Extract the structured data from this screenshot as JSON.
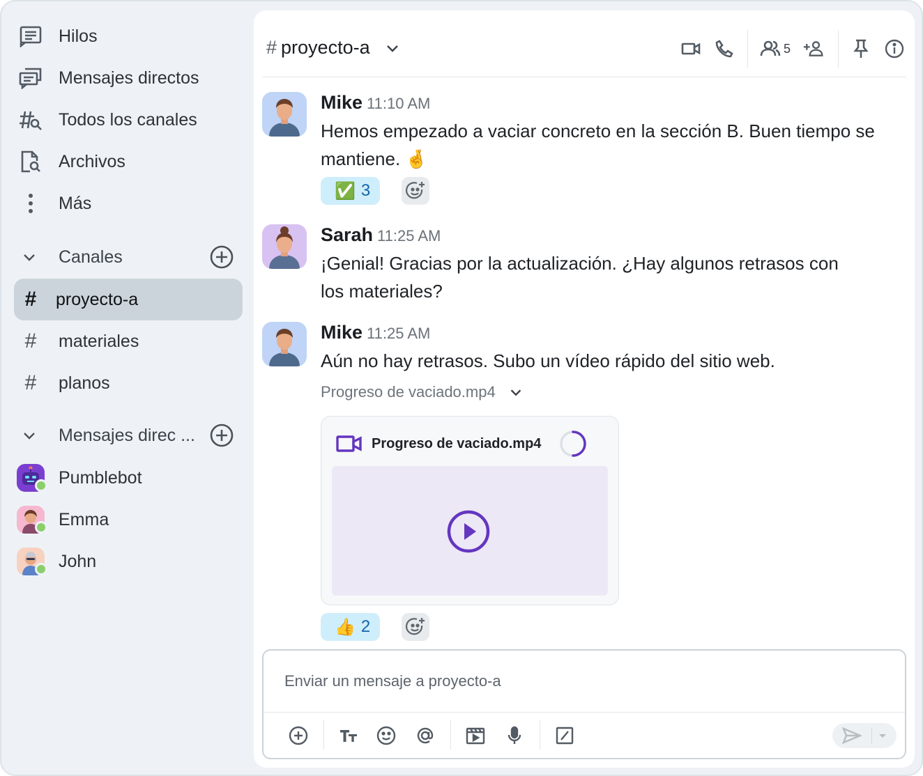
{
  "sidebar": {
    "nav": [
      {
        "label": "Hilos",
        "icon": "threads-icon"
      },
      {
        "label": "Mensajes directos",
        "icon": "direct-messages-icon"
      },
      {
        "label": "Todos los canales",
        "icon": "browse-channels-icon"
      },
      {
        "label": "Archivos",
        "icon": "files-icon"
      },
      {
        "label": "Más",
        "icon": "more-vertical-icon"
      }
    ],
    "channels_header": "Canales",
    "channels": [
      {
        "label": "proyecto-a",
        "active": true
      },
      {
        "label": "materiales",
        "active": false
      },
      {
        "label": "planos",
        "active": false
      }
    ],
    "dms_header": "Mensajes direc ...",
    "dms": [
      {
        "label": "Pumblebot",
        "status": "online"
      },
      {
        "label": "Emma",
        "status": "online"
      },
      {
        "label": "John",
        "status": "online"
      }
    ]
  },
  "channel": {
    "hash": "#",
    "name": "proyecto-a",
    "member_count": "5"
  },
  "messages": [
    {
      "author": "Mike",
      "time": "11:10 AM",
      "text": "Hemos empezado a vaciar concreto en la sección B. Buen tiempo se mantiene.",
      "emoji": "🤞",
      "reaction": {
        "emoji": "✅",
        "count": "3"
      }
    },
    {
      "author": "Sarah",
      "time": "11:25 AM",
      "text": "¡Genial! Gracias por la actualización. ¿Hay algunos retrasos con los materiales?"
    },
    {
      "author": "Mike",
      "time": "11:25 AM",
      "text": "Aún no hay retrasos. Subo un vídeo rápido del sitio web.",
      "attachment": {
        "label": "Progreso de vaciado.mp4",
        "file_name": "Progreso de vaciado.mp4"
      },
      "reaction": {
        "emoji": "👍",
        "count": "2"
      }
    }
  ],
  "composer": {
    "placeholder": "Enviar un mensaje a proyecto-a"
  },
  "colors": {
    "accent": "#6436c0",
    "reaction_bg": "#cfeefb",
    "active_channel_bg": "#ccd4db",
    "online": "#8bcf6a"
  }
}
